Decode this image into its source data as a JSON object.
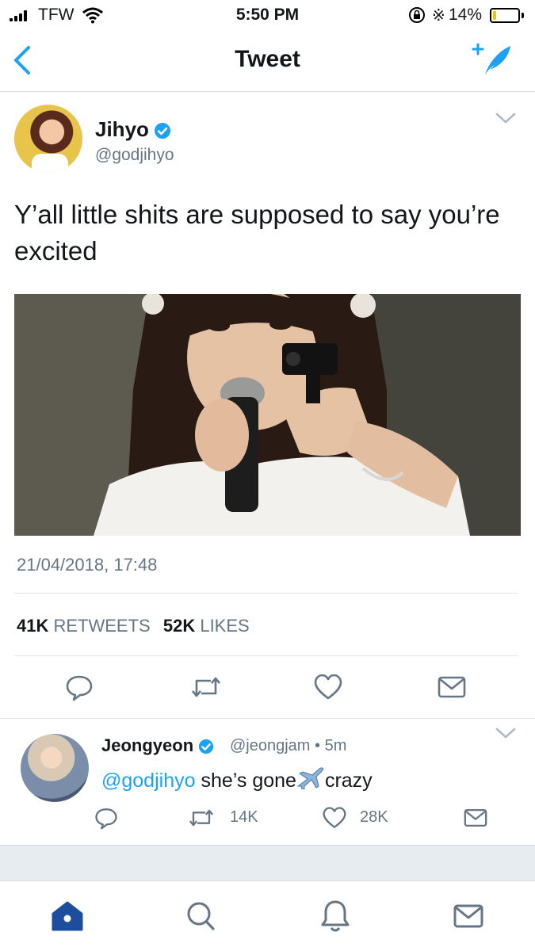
{
  "status_bar": {
    "carrier": "TFW",
    "time": "5:50 PM",
    "battery_percent": "14%",
    "battery_level": 0.14,
    "icons": [
      "signal-icon",
      "wifi-icon",
      "rotation-lock-icon",
      "bluetooth-icon",
      "battery-icon"
    ]
  },
  "nav": {
    "title": "Tweet",
    "back_icon": "chevron-left-icon",
    "compose_icon": "compose-feather-icon",
    "accent_color": "#1da1f2"
  },
  "tweet": {
    "author_name": "Jihyo",
    "author_handle": "@godjihyo",
    "verified": true,
    "text": "Y’all little shits are supposed to say you’re excited",
    "timestamp": "21/04/2018, 17:48",
    "retweets_count": "41K",
    "retweets_label": "RETWEETS",
    "likes_count": "52K",
    "likes_label": "LIKES",
    "actions": [
      "reply-icon",
      "retweet-icon",
      "like-icon",
      "share-icon"
    ]
  },
  "reply": {
    "author_name": "Jeongyeon",
    "author_handle": "@jeongjam",
    "separator": "•",
    "time_ago": "5m",
    "verified": true,
    "mention": "@godjihyo",
    "text_before": " she’s gone",
    "text_after": "crazy",
    "retweets": "14K",
    "likes": "28K"
  },
  "tab_bar": {
    "tabs": [
      "home-icon",
      "search-icon",
      "notifications-icon",
      "messages-icon"
    ],
    "active_tab": "home-icon"
  }
}
